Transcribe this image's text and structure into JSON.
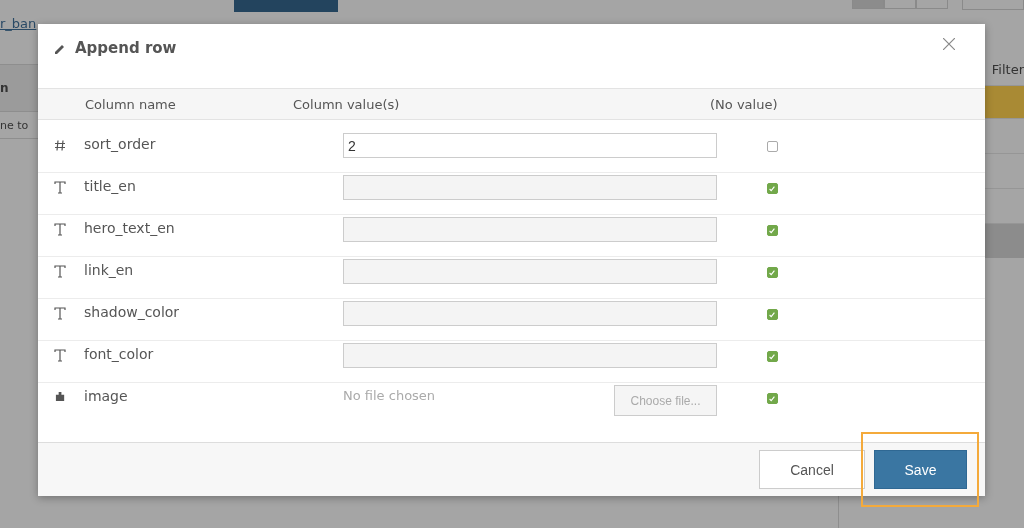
{
  "background": {
    "breadcrumb": "r_ban",
    "view_toggles": [
      {
        "selected": true
      },
      {
        "selected": false
      },
      {
        "selected": false
      }
    ],
    "filter_label": "Filter",
    "table_header": "n",
    "table_cell": "ne to"
  },
  "dialog": {
    "title": "Append row",
    "columns": [
      "Column name",
      "Column value(s)",
      "(No value)"
    ],
    "rows": [
      {
        "kind": "number",
        "name": "sort_order",
        "value": "2",
        "no_value": false
      },
      {
        "kind": "text",
        "name": "title_en",
        "no_value": true
      },
      {
        "kind": "text",
        "name": "hero_text_en",
        "no_value": true
      },
      {
        "kind": "text",
        "name": "link_en",
        "no_value": true
      },
      {
        "kind": "text",
        "name": "shadow_color",
        "no_value": true
      },
      {
        "kind": "text",
        "name": "font_color",
        "no_value": true
      },
      {
        "kind": "file",
        "name": "image",
        "file_status": "No file chosen",
        "file_button": "Choose file...",
        "no_value": true
      }
    ],
    "buttons": [
      {
        "label": "Cancel",
        "kind": "secondary",
        "highlighted": false
      },
      {
        "label": "Save",
        "kind": "primary",
        "highlighted": true
      }
    ]
  }
}
